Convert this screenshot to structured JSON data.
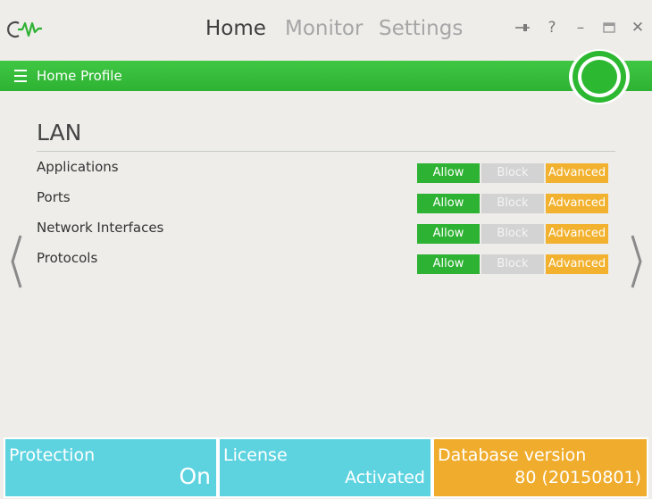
{
  "colors": {
    "accent_green": "#2eb233",
    "orange": "#f2b22f",
    "cyan": "#5ed3e0",
    "block_gray": "#d3d3d3"
  },
  "header": {
    "logo_icon": "glasswire-logo-icon",
    "tabs": [
      {
        "label": "Home",
        "active": true
      },
      {
        "label": "Monitor",
        "active": false
      },
      {
        "label": "Settings",
        "active": false
      }
    ],
    "window_buttons": {
      "pin": "⇥",
      "help": "?",
      "minimize": "–",
      "maximize": "▭",
      "close": "✕"
    }
  },
  "profile": {
    "label": "Home Profile",
    "menu_icon": "hamburger-menu-icon",
    "status_icon": "status-ring-icon"
  },
  "section": {
    "title": "LAN",
    "rows": [
      {
        "label": "Applications",
        "allow": "Allow",
        "block": "Block",
        "advanced": "Advanced"
      },
      {
        "label": "Ports",
        "allow": "Allow",
        "block": "Block",
        "advanced": "Advanced"
      },
      {
        "label": "Network Interfaces",
        "allow": "Allow",
        "block": "Block",
        "advanced": "Advanced"
      },
      {
        "label": "Protocols",
        "allow": "Allow",
        "block": "Block",
        "advanced": "Advanced"
      }
    ]
  },
  "footer": {
    "protection": {
      "title": "Protection",
      "value": "On"
    },
    "license": {
      "title": "License",
      "value": "Activated"
    },
    "database": {
      "title": "Database version",
      "value": "80 (20150801)"
    }
  }
}
